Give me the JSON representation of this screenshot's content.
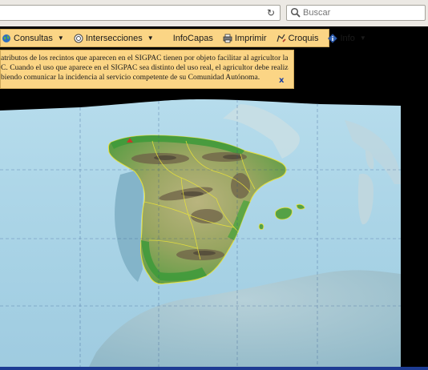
{
  "browser": {
    "search_placeholder": "Buscar",
    "reload_icon": "reload-icon"
  },
  "toolbar": {
    "items": [
      {
        "label": "Consultas",
        "icon": "globe-icon",
        "dropdown": true
      },
      {
        "label": "Intersecciones",
        "icon": "intersect-icon",
        "dropdown": true
      },
      {
        "label": "InfoCapas",
        "icon": "",
        "dropdown": false
      },
      {
        "label": "Imprimir",
        "icon": "printer-icon",
        "dropdown": false
      },
      {
        "label": "Croquis",
        "icon": "sketch-icon",
        "dropdown": false
      },
      {
        "label": "Info",
        "icon": "info-icon",
        "dropdown": true
      }
    ]
  },
  "notice": {
    "line1": "atributos de los recintos que aparecen en el SIGPAC tienen por objeto facilitar al agricultor la",
    "line2": "C. Cuando el uso que aparece en el SIGPAC sea distinto del uso real, el agricultor debe realizar su",
    "line3": "biendo comunicar la incidencia al servicio competente de su Comunidad Autónoma.",
    "close_symbol": "x"
  },
  "colors": {
    "toolbar_bg": "#fbd585",
    "sea": "#a9d4e6",
    "border_line": "#e8e23a",
    "frame": "#000000",
    "status_bar": "#1d3b93"
  }
}
